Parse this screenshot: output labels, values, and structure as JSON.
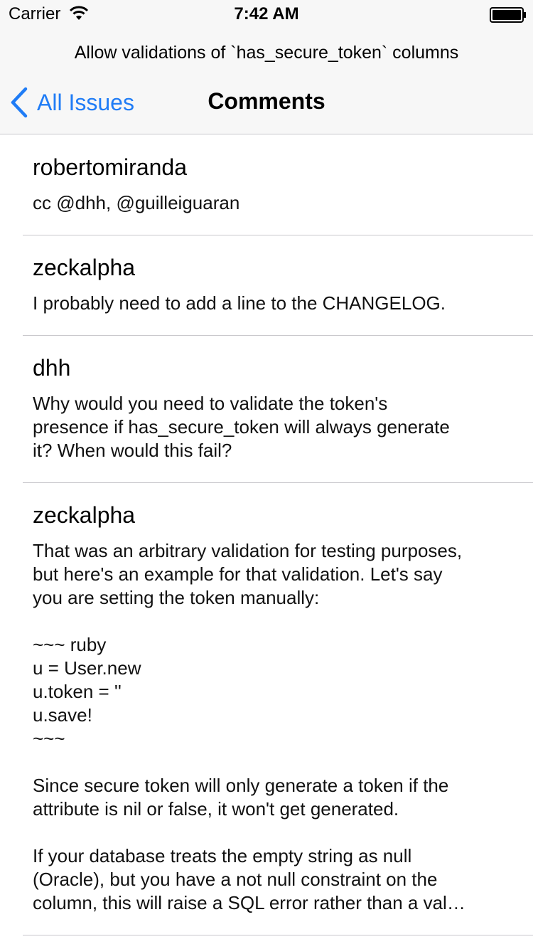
{
  "status_bar": {
    "carrier": "Carrier",
    "time": "7:42 AM",
    "wifi_icon": "wifi-icon",
    "battery_icon": "battery-icon"
  },
  "header": {
    "issue_title": "Allow validations of `has_secure_token` columns",
    "back_label": "All Issues",
    "back_icon": "chevron-left-icon",
    "title": "Comments",
    "accent_color": "#1f7cf6"
  },
  "comments": [
    {
      "author": "robertomiranda",
      "body": "cc @dhh, @guilleiguaran"
    },
    {
      "author": "zeckalpha",
      "body": "I probably need to add a line to the CHANGELOG."
    },
    {
      "author": "dhh",
      "body": "Why would you need to validate the token's\npresence if has_secure_token will always generate\nit? When would this fail?"
    },
    {
      "author": "zeckalpha",
      "body": "That was an arbitrary validation for testing purposes,\nbut here's an example for that validation. Let's say\nyou are setting the token manually:\n\n~~~ ruby\nu = User.new\nu.token = ''\nu.save!\n~~~\n\nSince secure token will only generate a token if the\nattribute is nil or false, it won't get generated.\n\nIf your database treats the empty string as null\n(Oracle), but you have a not null constraint on the\ncolumn, this will raise a SQL error rather than a val…"
    }
  ]
}
